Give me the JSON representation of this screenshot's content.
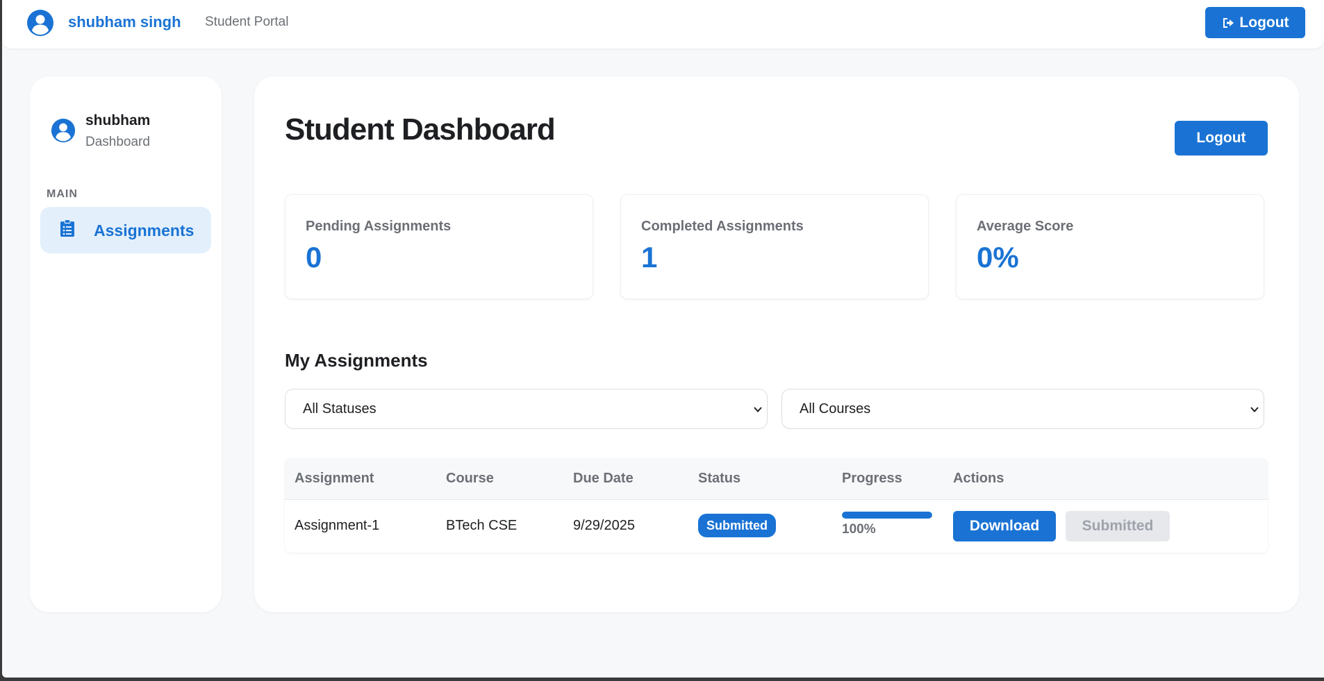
{
  "header": {
    "user_name": "shubham singh",
    "portal_label": "Student Portal",
    "logout_label": "Logout",
    "icons": {
      "avatar": "user-circle-icon",
      "logout": "sign-out-icon"
    }
  },
  "sidebar": {
    "username": "shubham",
    "subtitle": "Dashboard",
    "section_label": "MAIN",
    "items": [
      {
        "label": "Assignments",
        "icon": "clipboard-icon",
        "active": true
      }
    ]
  },
  "main": {
    "title": "Student Dashboard",
    "logout_label": "Logout",
    "stats": [
      {
        "label": "Pending Assignments",
        "value": "0"
      },
      {
        "label": "Completed Assignments",
        "value": "1"
      },
      {
        "label": "Average Score",
        "value": "0%"
      }
    ],
    "section_title": "My Assignments",
    "filters": {
      "status": "All Statuses",
      "course": "All Courses"
    },
    "table": {
      "columns": [
        "Assignment",
        "Course",
        "Due Date",
        "Status",
        "Progress",
        "Actions"
      ],
      "rows": [
        {
          "assignment": "Assignment-1",
          "course": "BTech CSE",
          "due_date": "9/29/2025",
          "status": "Submitted",
          "progress": 1.0,
          "progress_text": "100%",
          "download_label": "Download",
          "submitted_label": "Submitted"
        }
      ]
    }
  },
  "colors": {
    "accent": "#1a73d4",
    "active_bg": "#e3f0fc",
    "text_muted": "#6b6f75",
    "page_bg": "#f7f8fa"
  }
}
